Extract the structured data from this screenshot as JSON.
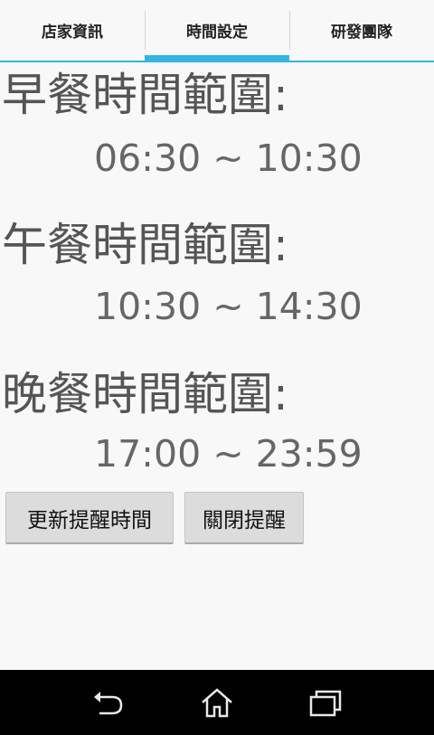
{
  "tabs": [
    {
      "label": "店家資訊",
      "active": false
    },
    {
      "label": "時間設定",
      "active": true
    },
    {
      "label": "研發團隊",
      "active": false
    }
  ],
  "meals": [
    {
      "heading": "早餐時間範圍:",
      "range": "06:30 ~ 10:30"
    },
    {
      "heading": "午餐時間範圍:",
      "range": "10:30 ~ 14:30"
    },
    {
      "heading": "晚餐時間範圍:",
      "range": "17:00 ~ 23:59"
    }
  ],
  "buttons": {
    "update_label": "更新提醒時間",
    "close_label": "關閉提醒"
  },
  "navbar": {
    "icons": [
      "back-icon",
      "home-icon",
      "recent-apps-icon"
    ]
  },
  "colors": {
    "accent": "#33b5e5",
    "background": "#f8f8f8",
    "navbar": "#000000"
  }
}
